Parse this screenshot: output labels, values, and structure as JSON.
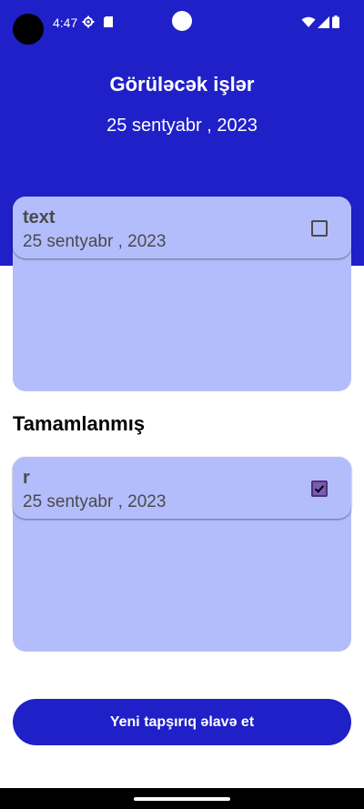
{
  "status_bar": {
    "time": "4:47"
  },
  "header": {
    "title": "Görüləcək işlər",
    "date": "25 sentyabr , 2023"
  },
  "todo_tasks": [
    {
      "title": "text",
      "date": "25 sentyabr , 2023",
      "checked": false
    }
  ],
  "completed_section": {
    "heading": "Tamamlanmış",
    "tasks": [
      {
        "title": "r",
        "date": "25 sentyabr , 2023",
        "checked": true
      }
    ]
  },
  "add_button": {
    "label": "Yeni tapşırıq əlavə et"
  },
  "colors": {
    "primary": "#2020c8",
    "panel": "#b4bdfc",
    "checkbox_checked": "#7a5bb4"
  }
}
